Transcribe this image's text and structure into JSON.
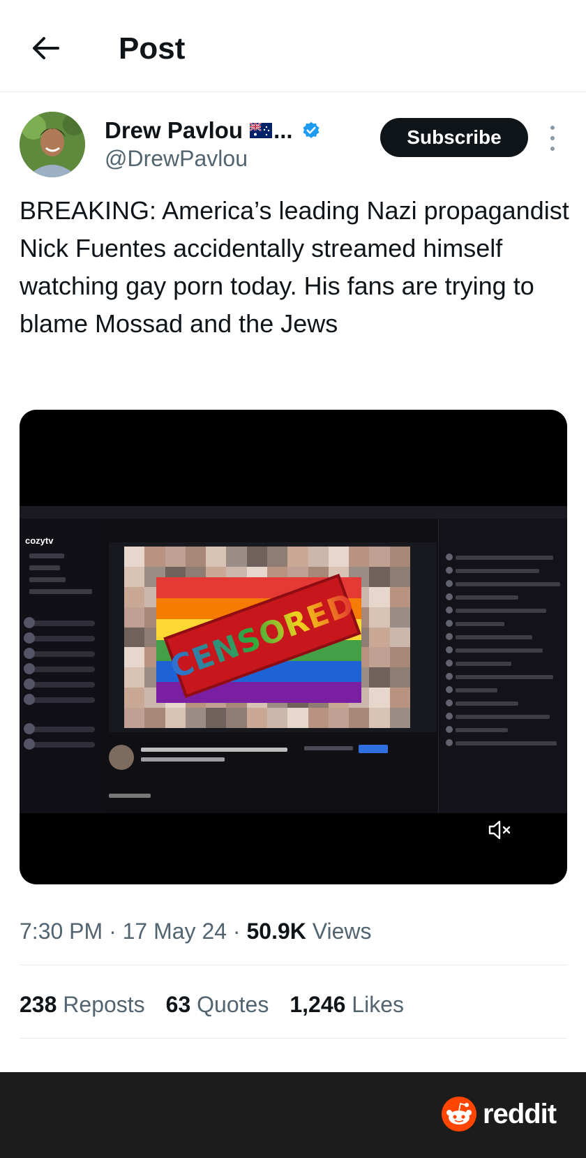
{
  "header": {
    "title": "Post",
    "back_icon": "arrow-left-icon"
  },
  "author": {
    "name": "Drew Pavlou",
    "flag": "🇦🇺",
    "name_ellipsis": "...",
    "handle": "@DrewPavlou",
    "verified": true,
    "verified_color": "#1d9bf0"
  },
  "subscribe_label": "Subscribe",
  "post": {
    "text": "BREAKING: America’s leading Nazi propagandist Nick Fuentes accidentally streamed himself watching gay porn today. His fans are trying to blame Mossad and the Jews"
  },
  "media": {
    "type": "video",
    "muted": true,
    "screen": {
      "site_logo": "cozytv",
      "censored_label": "CENSORED"
    }
  },
  "meta": {
    "time": "7:30 PM",
    "sep1": " · ",
    "date": "17 May 24",
    "sep2": " · ",
    "views_count": "50.9K",
    "views_label": " Views"
  },
  "stats": {
    "reposts_count": "238",
    "reposts_label": " Reposts",
    "quotes_count": "63",
    "quotes_label": " Quotes",
    "likes_count": "1,246",
    "likes_label": " Likes"
  },
  "footer": {
    "brand": "reddit",
    "brand_color": "#ff4500"
  }
}
